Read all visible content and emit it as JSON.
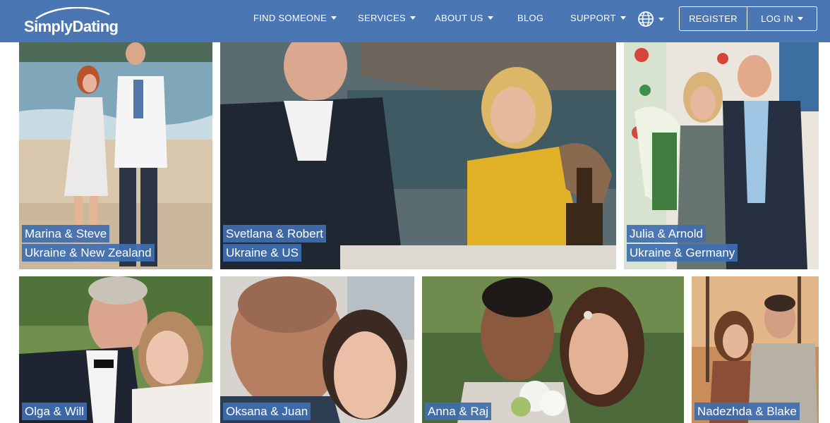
{
  "brand": {
    "logo_text": "SimplyDating"
  },
  "nav": {
    "find_someone": "FIND SOMEONE",
    "services": "SERVICES",
    "about_us": "ABOUT US",
    "blog": "BLOG",
    "support": "SUPPORT"
  },
  "auth": {
    "register": "REGISTER",
    "login": "LOG IN"
  },
  "couples": [
    {
      "names": "Marina & Steve",
      "countries": "Ukraine & New Zealand"
    },
    {
      "names": "Svetlana & Robert",
      "countries": "Ukraine & US"
    },
    {
      "names": "Julia & Arnold",
      "countries": "Ukraine & Germany"
    },
    {
      "names": "Olga & Will"
    },
    {
      "names": "Oksana & Juan"
    },
    {
      "names": "Anna & Raj"
    },
    {
      "names": "Nadezhda & Blake"
    }
  ],
  "colors": {
    "header": "#4a76b3",
    "caption_bg": "#3f6eb0",
    "text": "#ffffff"
  }
}
